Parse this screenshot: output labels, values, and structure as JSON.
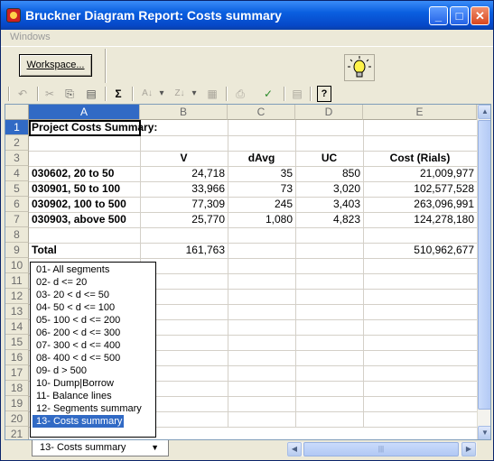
{
  "window": {
    "title": "Bruckner Diagram Report: Costs summary",
    "controls": {
      "minimize": "_",
      "maximize": "□",
      "close": "✕"
    }
  },
  "menu": {
    "windows": "Windows"
  },
  "panel": {
    "workspace_button": "Workspace..."
  },
  "toolbar": {
    "undo": "↶",
    "cut": "✂",
    "copy": "⎘",
    "paste": "▤",
    "sum": "Σ",
    "sort_asc": "A↓",
    "sort_desc": "Z↓",
    "dropdown": "▾",
    "help": "?"
  },
  "sheet": {
    "columns": [
      "A",
      "B",
      "C",
      "D",
      "E"
    ],
    "row_numbers": [
      "1",
      "2",
      "3",
      "4",
      "5",
      "6",
      "7",
      "8",
      "9",
      "10",
      "11",
      "12",
      "13",
      "14",
      "15",
      "16",
      "17",
      "18",
      "19",
      "20",
      "21"
    ],
    "cells": {
      "r1": {
        "a": "Project Costs Summary:"
      },
      "r3": {
        "b": "V",
        "c": "dAvg",
        "d": "UC",
        "e": "Cost (Rials)"
      },
      "r4": {
        "a": "030602, 20 to 50",
        "b": "24,718",
        "c": "35",
        "d": "850",
        "e": "21,009,977"
      },
      "r5": {
        "a": "030901, 50 to 100",
        "b": "33,966",
        "c": "73",
        "d": "3,020",
        "e": "102,577,528"
      },
      "r6": {
        "a": "030902, 100 to 500",
        "b": "77,309",
        "c": "245",
        "d": "3,403",
        "e": "263,096,991"
      },
      "r7": {
        "a": "030903, above 500",
        "b": "25,770",
        "c": "1,080",
        "d": "4,823",
        "e": "124,278,180"
      },
      "r9": {
        "a": "Total",
        "b": "161,763",
        "e": "510,962,677"
      }
    },
    "selected_cell": "A1"
  },
  "tabs": {
    "active": "13-  Costs summary",
    "list": [
      "01-  All segments",
      "02-  d <= 20",
      "03-  20 < d <= 50",
      "04-  50 < d <= 100",
      "05-  100 < d <= 200",
      "06-  200 < d <= 300",
      "07-  300 < d <= 400",
      "08-  400 < d <= 500",
      "09-  d > 500",
      "10-  Dump|Borrow",
      "11-  Balance lines",
      "12-  Segments summary",
      "13-  Costs summary"
    ],
    "selected_index": 12
  },
  "scroll": {
    "up": "▲",
    "down": "▼",
    "left": "◀",
    "right": "▶",
    "grip": "|||"
  }
}
